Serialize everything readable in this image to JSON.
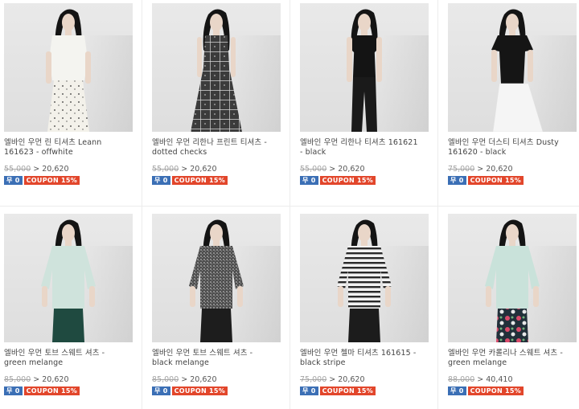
{
  "products": [
    {
      "name": "엘바인 우먼 린 티셔츠 Leann\n161623 - offwhite",
      "old_price": "55,000",
      "price": "> 20,620",
      "badge_left": "무 0",
      "badge_coupon": "COUPON 15%",
      "top": "#f4f4f0",
      "bottom": "#f2f0ea",
      "pattern": "dots",
      "style": "top-skirt"
    },
    {
      "name": "엘바인 우먼 리한나 프린트 티셔츠 -\ndotted checks",
      "old_price": "55,000",
      "price": "> 20,620",
      "badge_left": "무 0",
      "badge_coupon": "COUPON 15%",
      "top": "#6a6a6a",
      "bottom": "#5c5c5c",
      "pattern": "checks",
      "style": "dress"
    },
    {
      "name": "엘바인 우먼 리한나 티셔츠 161621\n- black",
      "old_price": "55,000",
      "price": "> 20,620",
      "badge_left": "무 0",
      "badge_coupon": "COUPON 15%",
      "top": "#141414",
      "bottom": "#1a1a1a",
      "pattern": "none",
      "style": "tank-pants"
    },
    {
      "name": "엘바인 우먼 더스티 티셔츠 Dusty\n161620 - black",
      "old_price": "75,000",
      "price": "> 20,620",
      "badge_left": "무 0",
      "badge_coupon": "COUPON 15%",
      "top": "#151515",
      "bottom": "#f5f5f5",
      "pattern": "none",
      "style": "tee-skirt"
    },
    {
      "name": "엘바인 우먼 토브 스웨트 셔츠 -\ngreen melange",
      "old_price": "85,000",
      "price": "> 20,620",
      "badge_left": "무 0",
      "badge_coupon": "COUPON 15%",
      "top": "#cfe3dc",
      "bottom": "#1f4a40",
      "pattern": "none",
      "style": "sweat"
    },
    {
      "name": "엘바인 우먼 토브 스웨트 셔츠 -\nblack melange",
      "old_price": "85,000",
      "price": "> 20,620",
      "badge_left": "무 0",
      "badge_coupon": "COUPON 15%",
      "top": "#5a5a5a",
      "bottom": "#1d1d1d",
      "pattern": "melange",
      "style": "sweat"
    },
    {
      "name": "엘바인 우먼 첼마 티셔츠 161615 -\nblack stripe",
      "old_price": "75,000",
      "price": "> 20,620",
      "badge_left": "무 0",
      "badge_coupon": "COUPON 15%",
      "top": "#eeeeee",
      "bottom": "#1c1c1c",
      "pattern": "stripes",
      "style": "sweat"
    },
    {
      "name": "엘바인 우먼 카롤리나 스웨트 셔츠 -\ngreen melange",
      "old_price": "88,000",
      "price": "> 40,410",
      "badge_left": "무 0",
      "badge_coupon": "COUPON 15%",
      "top": "#c9e2da",
      "bottom": "#2f5a66",
      "pattern": "floral",
      "style": "sweat"
    }
  ]
}
